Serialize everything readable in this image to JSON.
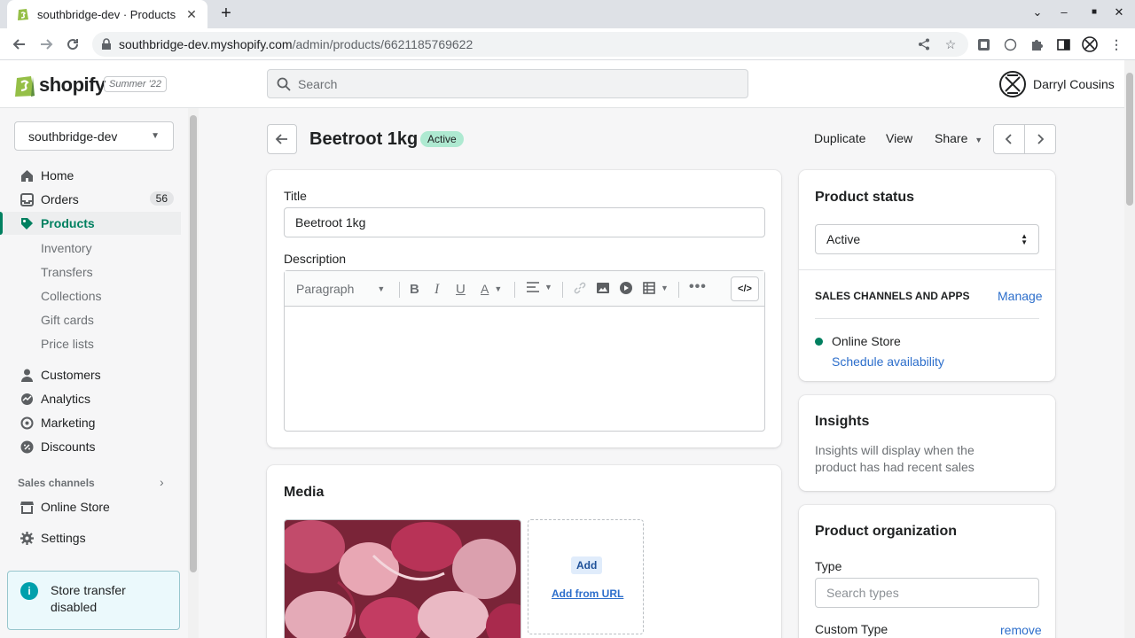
{
  "browser": {
    "tab_title": "southbridge-dev · Products",
    "url_host": "southbridge-dev.myshopify.com",
    "url_path": "/admin/products/6621185769622"
  },
  "topbar": {
    "logo_text": "shopify",
    "edition_badge": "Summer '22",
    "search_placeholder": "Search",
    "user_name": "Darryl Cousins"
  },
  "sidebar": {
    "store_name": "southbridge-dev",
    "items": [
      {
        "label": "Home",
        "icon": "home-icon"
      },
      {
        "label": "Orders",
        "icon": "orders-icon",
        "count": "56"
      },
      {
        "label": "Products",
        "icon": "tag-icon",
        "active": true
      },
      {
        "label": "Customers",
        "icon": "person-icon"
      },
      {
        "label": "Analytics",
        "icon": "analytics-icon"
      },
      {
        "label": "Marketing",
        "icon": "marketing-icon"
      },
      {
        "label": "Discounts",
        "icon": "discount-icon"
      }
    ],
    "product_sub": [
      "Inventory",
      "Transfers",
      "Collections",
      "Gift cards",
      "Price lists"
    ],
    "sales_channels_title": "Sales channels",
    "online_store": "Online Store",
    "settings": "Settings",
    "banner_text": "Store transfer disabled"
  },
  "page": {
    "title": "Beetroot 1kg",
    "status_badge": "Active",
    "actions": {
      "duplicate": "Duplicate",
      "view": "View",
      "share": "Share"
    }
  },
  "form": {
    "title_label": "Title",
    "title_value": "Beetroot 1kg",
    "description_label": "Description",
    "paragraph_select": "Paragraph"
  },
  "media": {
    "heading": "Media",
    "add_button": "Add",
    "add_from_url": "Add from URL"
  },
  "status_card": {
    "heading": "Product status",
    "value": "Active",
    "channels_title": "SALES CHANNELS AND APPS",
    "manage": "Manage",
    "channel": "Online Store",
    "schedule": "Schedule availability"
  },
  "insights": {
    "heading": "Insights",
    "text": "Insights will display when the product has had recent sales"
  },
  "organization": {
    "heading": "Product organization",
    "type_label": "Type",
    "type_placeholder": "Search types",
    "custom_type_label": "Custom Type",
    "remove": "remove"
  },
  "colors": {
    "accent": "#008060",
    "link": "#2c6ecb",
    "active_pill": "#aee9d1"
  }
}
